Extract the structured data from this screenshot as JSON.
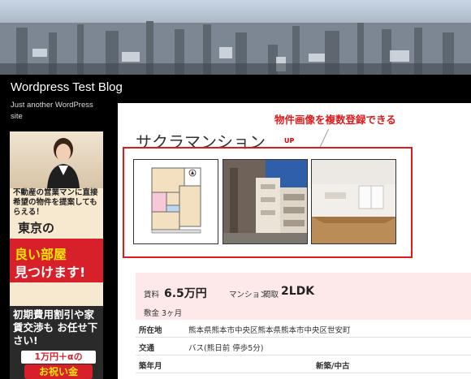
{
  "blog": {
    "title": "Wordpress Test Blog",
    "tagline": "Just another WordPress site"
  },
  "ad": {
    "text1": "不動産の営業マンに直接 希望の物件を提案してもらえる！",
    "tokyo": "東京の",
    "red1": "良い部屋",
    "red2": "見つけます!",
    "bottom": "初期費用割引や家賃交渉も お任せ下さい!",
    "yen": "1万円＋αの",
    "celebrate": "お祝い金"
  },
  "property": {
    "title": "サクラマンション",
    "badge": "UP",
    "callout": "物件画像を複数登録できる",
    "price_label": "賃料",
    "price_value": "6.5万円",
    "type_label": "マンション",
    "layout_label": "間取",
    "layout_value": "2LDK",
    "deposit": "敷金 3ヶ月"
  },
  "spec": {
    "rows": [
      {
        "label": "所在地",
        "value": "熊本県熊本市中央区熊本県熊本市中央区世安町"
      },
      {
        "label": "交通",
        "value": "バス(熊日前 停歩5分)"
      },
      {
        "label": "築年月",
        "value": "",
        "label2": "新築/中古"
      }
    ]
  },
  "colors": {
    "accent": "#e01a1a",
    "price_bg": "#fde9ea",
    "header_bg": "#000000"
  }
}
